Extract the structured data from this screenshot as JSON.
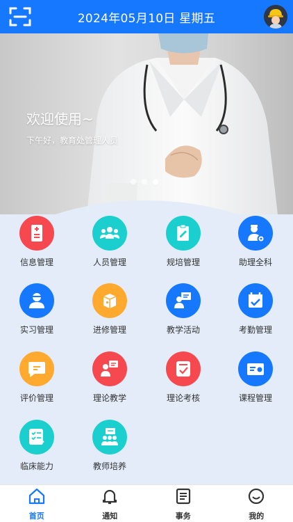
{
  "header": {
    "date_text": "2024年05月10日 星期五"
  },
  "banner": {
    "welcome": "欢迎使用~",
    "greeting": "下午好，教育处管理人员",
    "slide_count": 3,
    "active_slide": 3
  },
  "menu": [
    {
      "label": "信息管理",
      "color": "#f5494f",
      "icon": "document-plus-icon"
    },
    {
      "label": "人员管理",
      "color": "#1ccfcf",
      "icon": "people-group-icon"
    },
    {
      "label": "规培管理",
      "color": "#1ccfcf",
      "icon": "clipboard-edit-icon"
    },
    {
      "label": "助理全科",
      "color": "#1677ff",
      "icon": "doctor-gear-icon"
    },
    {
      "label": "实习管理",
      "color": "#1677ff",
      "icon": "student-user-icon"
    },
    {
      "label": "进修管理",
      "color": "#ffaa2e",
      "icon": "package-icon"
    },
    {
      "label": "教学活动",
      "color": "#1677ff",
      "icon": "teacher-board-icon"
    },
    {
      "label": "考勤管理",
      "color": "#1677ff",
      "icon": "calendar-check-icon"
    },
    {
      "label": "评价管理",
      "color": "#ffaa2e",
      "icon": "chat-message-icon"
    },
    {
      "label": "理论教学",
      "color": "#f5494f",
      "icon": "lecture-icon"
    },
    {
      "label": "理论考核",
      "color": "#f5494f",
      "icon": "exam-paper-icon"
    },
    {
      "label": "课程管理",
      "color": "#1677ff",
      "icon": "course-card-icon"
    },
    {
      "label": "临床能力",
      "color": "#1ccfcf",
      "icon": "clinical-checklist-icon"
    },
    {
      "label": "教师培养",
      "color": "#1ccfcf",
      "icon": "teacher-training-icon"
    }
  ],
  "tabbar": {
    "items": [
      {
        "label": "首页",
        "icon": "home-icon",
        "active": true
      },
      {
        "label": "通知",
        "icon": "bell-icon",
        "active": false
      },
      {
        "label": "事务",
        "icon": "list-doc-icon",
        "active": false
      },
      {
        "label": "我的",
        "icon": "smile-icon",
        "active": false
      }
    ],
    "active_color": "#1677ff"
  }
}
